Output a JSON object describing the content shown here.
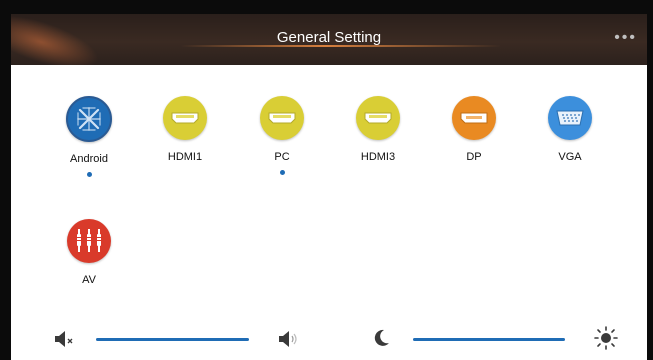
{
  "header": {
    "title": "General Setting",
    "more_label": "•••"
  },
  "sources": [
    {
      "label": "Android",
      "icon": "android-logo-icon",
      "color": "#1f6cb5",
      "active": true
    },
    {
      "label": "HDMI1",
      "icon": "hdmi-icon",
      "color": "#d9ce35",
      "active": false
    },
    {
      "label": "PC",
      "icon": "hdmi-icon",
      "color": "#d9ce35",
      "active": true
    },
    {
      "label": "HDMI3",
      "icon": "hdmi-icon",
      "color": "#d9ce35",
      "active": false
    },
    {
      "label": "DP",
      "icon": "displayport-icon",
      "color": "#e98a22",
      "active": false
    },
    {
      "label": "VGA",
      "icon": "vga-icon",
      "color": "#3c8fdc",
      "active": false
    },
    {
      "label": "AV",
      "icon": "av-rca-icon",
      "color": "#d93a2a",
      "active": false
    }
  ],
  "controls": {
    "volume": {
      "mute_icon": "speaker-mute-icon",
      "max_icon": "speaker-icon"
    },
    "brightness": {
      "min_icon": "moon-icon",
      "max_icon": "sun-icon"
    }
  },
  "colors": {
    "accent": "#1f6cb5",
    "header_bg": "#2e2420",
    "active_dot": "#1f6cb5"
  }
}
